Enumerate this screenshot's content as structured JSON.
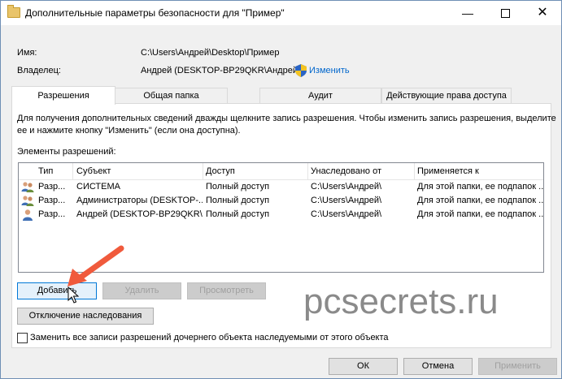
{
  "window": {
    "title": "Дополнительные параметры безопасности  для \"Пример\"",
    "minimize_glyph": "—",
    "close_glyph": "✕"
  },
  "info": {
    "name_label": "Имя:",
    "name_value": "C:\\Users\\Андрей\\Desktop\\Пример",
    "owner_label": "Владелец:",
    "owner_value": "Андрей (DESKTOP-BP29QKR\\Андрей)",
    "change_link": "Изменить"
  },
  "tabs": [
    {
      "label": "Разрешения",
      "active": true
    },
    {
      "label": "Общая папка",
      "active": false
    },
    {
      "label": "Аудит",
      "active": false
    },
    {
      "label": "Действующие права доступа",
      "active": false
    }
  ],
  "instructions_line1": "Для получения дополнительных сведений дважды щелкните запись разрешения. Чтобы изменить запись разрешения, выделите",
  "instructions_line2": "ее и нажмите кнопку \"Изменить\" (если она доступна).",
  "entries_label": "Элементы разрешений:",
  "columns": [
    "Тип",
    "Субъект",
    "Доступ",
    "Унаследовано от",
    "Применяется к"
  ],
  "rows": [
    {
      "icon": "group-icon",
      "type": "Разр...",
      "principal": "СИСТЕМА",
      "access": "Полный доступ",
      "inherited": "C:\\Users\\Андрей\\",
      "applies": "Для этой папки, ее подпапок ..."
    },
    {
      "icon": "group-icon",
      "type": "Разр...",
      "principal": "Администраторы (DESKTOP-...",
      "access": "Полный доступ",
      "inherited": "C:\\Users\\Андрей\\",
      "applies": "Для этой папки, ее подпапок ..."
    },
    {
      "icon": "user-icon",
      "type": "Разр...",
      "principal": "Андрей (DESKTOP-BP29QKR\\...",
      "access": "Полный доступ",
      "inherited": "C:\\Users\\Андрей\\",
      "applies": "Для этой папки, ее подпапок ..."
    }
  ],
  "buttons": {
    "add": "Добавить",
    "remove": "Удалить",
    "view": "Просмотреть",
    "disable_inheritance": "Отключение наследования",
    "ok": "ОК",
    "cancel": "Отмена",
    "apply": "Применить"
  },
  "replace_checkbox_label": "Заменить все записи разрешений дочернего объекта наследуемыми от этого объекта",
  "watermark": "pcsecrets.ru",
  "colors": {
    "arrow": "#f05a3c",
    "link": "#0066cc",
    "focus_border": "#0078d7"
  }
}
